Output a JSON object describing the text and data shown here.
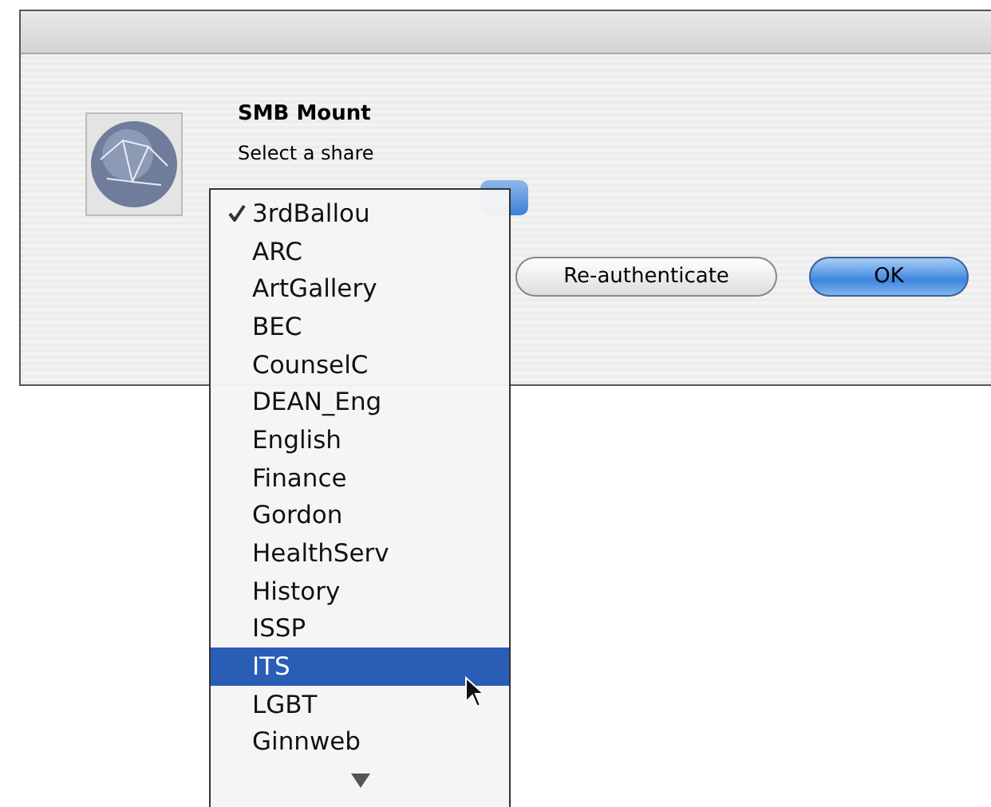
{
  "dialog": {
    "title": "SMB Mount",
    "prompt": "Select a share"
  },
  "buttons": [
    {
      "label": "Re-authenticate",
      "kind": "secondary"
    },
    {
      "label": "OK",
      "kind": "default"
    }
  ],
  "share_menu": {
    "items": [
      {
        "label": "3rdBallou",
        "checked": true,
        "selected": false
      },
      {
        "label": "ARC",
        "checked": false,
        "selected": false
      },
      {
        "label": "ArtGallery",
        "checked": false,
        "selected": false
      },
      {
        "label": "BEC",
        "checked": false,
        "selected": false
      },
      {
        "label": "CounselC",
        "checked": false,
        "selected": false
      },
      {
        "label": "DEAN_Eng",
        "checked": false,
        "selected": false
      },
      {
        "label": "English",
        "checked": false,
        "selected": false
      },
      {
        "label": "Finance",
        "checked": false,
        "selected": false
      },
      {
        "label": "Gordon",
        "checked": false,
        "selected": false
      },
      {
        "label": "HealthServ",
        "checked": false,
        "selected": false
      },
      {
        "label": "History",
        "checked": false,
        "selected": false
      },
      {
        "label": "ISSP",
        "checked": false,
        "selected": false
      },
      {
        "label": "ITS",
        "checked": false,
        "selected": true
      },
      {
        "label": "LGBT",
        "checked": false,
        "selected": false
      },
      {
        "label": "Ginnweb",
        "checked": false,
        "selected": false
      }
    ]
  }
}
